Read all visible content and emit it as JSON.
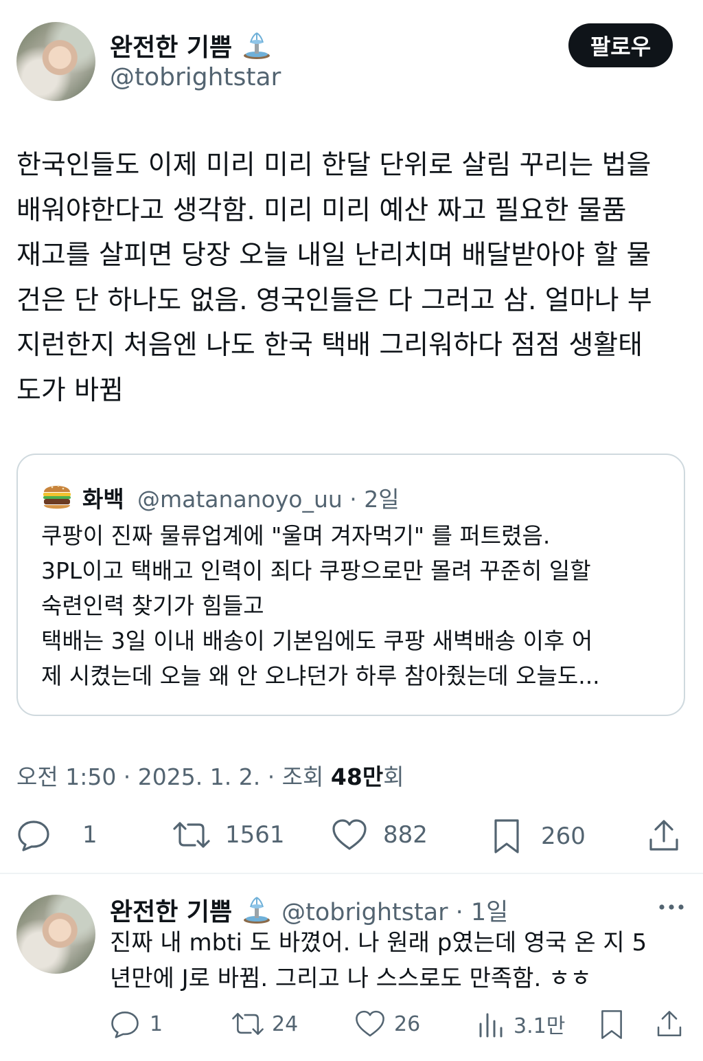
{
  "main_tweet": {
    "author_name": "완전한 기쁨",
    "author_handle": "@tobrightstar",
    "follow_label": "팔로우",
    "text": "한국인들도 이제 미리 미리 한달 단위로 살림 꾸리는 법을\n배워야한다고 생각함. 미리 미리 예산 짜고 필요한 물품\n재고를 살피면 당장 오늘 내일 난리치며 배달받아야 할 물\n건은 단 하나도 없음. 영국인들은 다 그러고 삼. 얼마나 부\n지런한지 처음엔 나도 한국 택배 그리워하다 점점 생활태\n도가 바뀜",
    "quote": {
      "name": "화백",
      "handle_time": "@matananoyo_uu · 2일",
      "text": "쿠팡이 진짜 물류업계에 \"울며 겨자먹기\" 를 퍼트렸음.\n3PL이고 택배고 인력이 죄다 쿠팡으로만 몰려 꾸준히 일할\n숙련인력 찾기가 힘들고\n택배는 3일 이내 배송이 기본임에도 쿠팡 새벽배송 이후 어\n제 시켰는데 오늘 왜 안 오냐던가 하루 참아줬는데 오늘도..."
    },
    "meta_prefix": "오전 1:50 · 2025. 1. 2. · 조회 ",
    "meta_views": "48만",
    "meta_suffix": "회",
    "stats": {
      "replies": "1",
      "reposts": "1561",
      "likes": "882",
      "bookmarks": "260"
    }
  },
  "reply": {
    "author_name": "완전한 기쁨",
    "handle_time": "@tobrightstar · 1일",
    "text": "진짜 내 mbti 도 바꼈어. 나 원래 p였는데 영국 온 지 5\n년만에 J로 바뀜. 그리고 나 스스로도 만족함. ㅎㅎ",
    "stats": {
      "replies": "1",
      "reposts": "24",
      "likes": "26",
      "views": "3.1만"
    }
  },
  "icons": {
    "fountain": "fountain-emoji-icon",
    "burger": "burger-emoji-icon"
  }
}
